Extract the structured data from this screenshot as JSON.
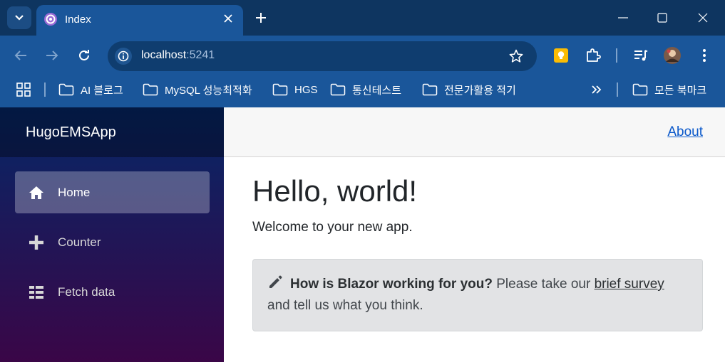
{
  "browser": {
    "tab_title": "Index",
    "url_host": "localhost",
    "url_port": ":5241",
    "bookmarks": [
      "AI 블로그",
      "MySQL 성능최적화",
      "HGS",
      "통신테스트",
      "전문가활용 적기"
    ],
    "all_bookmarks": "모든 북마크",
    "colors": {
      "tabstrip": "#0e3560",
      "toolbar": "#1a569a",
      "omnibox": "#0f3d6f"
    }
  },
  "app": {
    "brand": "HugoEMSApp",
    "nav": [
      {
        "label": "Home",
        "icon": "home-icon",
        "active": true
      },
      {
        "label": "Counter",
        "icon": "plus-icon",
        "active": false
      },
      {
        "label": "Fetch data",
        "icon": "list-icon",
        "active": false
      }
    ],
    "about_link": "About",
    "heading": "Hello, world!",
    "welcome": "Welcome to your new app.",
    "survey": {
      "question": "How is Blazor working for you?",
      "prompt": "Please take our",
      "link": "brief survey",
      "tail": "and tell us what you think."
    },
    "colors": {
      "link": "#0a58ca",
      "sidebar_top": "#052767",
      "sidebar_bottom": "#3a0647",
      "alert_bg": "#e2e3e5"
    }
  }
}
